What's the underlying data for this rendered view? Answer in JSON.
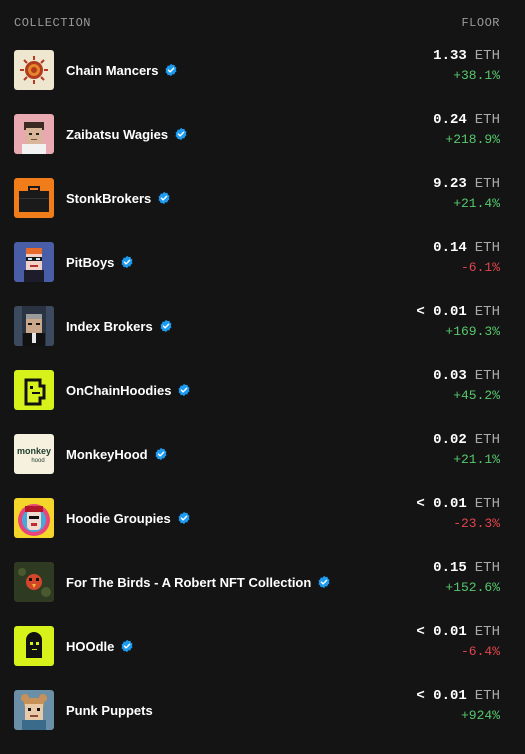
{
  "header": {
    "collection_label": "COLLECTION",
    "floor_label": "FLOOR"
  },
  "colors": {
    "positive": "#56c76b",
    "negative": "#e0454c",
    "verified": "#1d9bf0"
  },
  "rows": [
    {
      "name": "Chain Mancers",
      "verified": true,
      "floor": "1.33",
      "unit": "ETH",
      "change": "+38.1%",
      "direction": "up",
      "icon": "sun-emblem-icon"
    },
    {
      "name": "Zaibatsu Wagies",
      "verified": true,
      "floor": "0.24",
      "unit": "ETH",
      "change": "+218.9%",
      "direction": "up",
      "icon": "wagie-face-icon"
    },
    {
      "name": "StonkBrokers",
      "verified": true,
      "floor": "9.23",
      "unit": "ETH",
      "change": "+21.4%",
      "direction": "up",
      "icon": "briefcase-icon"
    },
    {
      "name": "PitBoys",
      "verified": true,
      "floor": "0.14",
      "unit": "ETH",
      "change": "-6.1%",
      "direction": "down",
      "icon": "pixel-face-icon"
    },
    {
      "name": "Index Brokers",
      "verified": true,
      "floor": "< 0.01",
      "unit": "ETH",
      "change": "+169.3%",
      "direction": "up",
      "icon": "broker-portrait-icon"
    },
    {
      "name": "OnChainHoodies",
      "verified": true,
      "floor": "0.03",
      "unit": "ETH",
      "change": "+45.2%",
      "direction": "up",
      "icon": "hoodie-icon"
    },
    {
      "name": "MonkeyHood",
      "verified": true,
      "floor": "0.02",
      "unit": "ETH",
      "change": "+21.1%",
      "direction": "up",
      "icon": "monkeyhood-logo-icon"
    },
    {
      "name": "Hoodie Groupies",
      "verified": true,
      "floor": "< 0.01",
      "unit": "ETH",
      "change": "-23.3%",
      "direction": "down",
      "icon": "groupie-face-icon"
    },
    {
      "name": "For The Birds - A Robert NFT Collection",
      "verified": true,
      "floor": "0.15",
      "unit": "ETH",
      "change": "+152.6%",
      "direction": "up",
      "icon": "bird-icon"
    },
    {
      "name": "HOOdle",
      "verified": true,
      "floor": "< 0.01",
      "unit": "ETH",
      "change": "-6.4%",
      "direction": "down",
      "icon": "hoodle-icon"
    },
    {
      "name": "Punk Puppets",
      "verified": false,
      "floor": "< 0.01",
      "unit": "ETH",
      "change": "+924%",
      "direction": "up",
      "icon": "puppet-face-icon"
    }
  ]
}
